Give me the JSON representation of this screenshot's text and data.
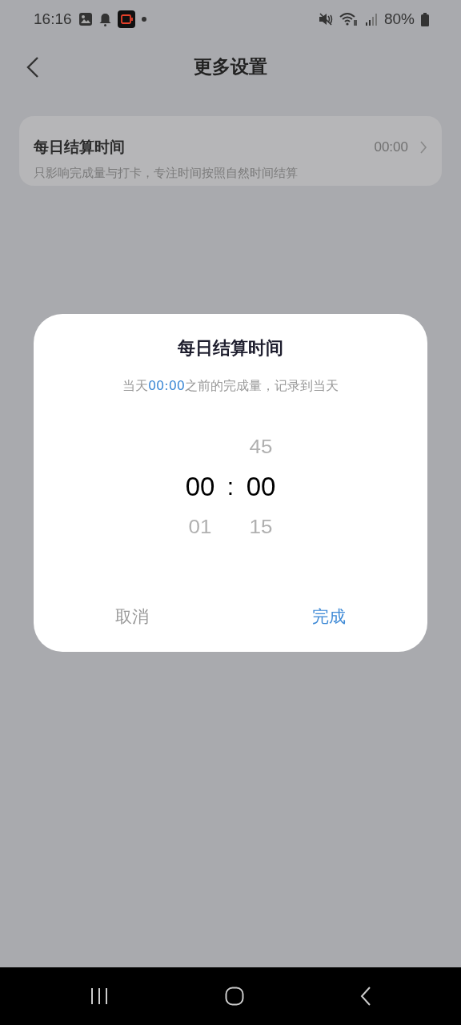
{
  "status_bar": {
    "time": "16:16",
    "battery": "80%"
  },
  "header": {
    "title": "更多设置"
  },
  "setting": {
    "title": "每日结算时间",
    "value": "00:00",
    "description": "只影响完成量与打卡，专注时间按照自然时间结算"
  },
  "dialog": {
    "title": "每日结算时间",
    "subtitle": [
      {
        "text": "当天",
        "highlight": false
      },
      {
        "text": "00:00",
        "highlight": true
      },
      {
        "text": "之前的完成量，记录到当天",
        "highlight": false
      }
    ],
    "hours": [
      {
        "text": "00",
        "selected": true
      },
      {
        "text": "01",
        "selected": false
      }
    ],
    "separator": ":",
    "minutes": [
      {
        "text": "45",
        "selected": false
      },
      {
        "text": "00",
        "selected": true
      },
      {
        "text": "15",
        "selected": false
      }
    ],
    "buttons": [
      {
        "label": "取消",
        "kind": "cancel"
      },
      {
        "label": "完成",
        "kind": "confirm"
      }
    ]
  }
}
